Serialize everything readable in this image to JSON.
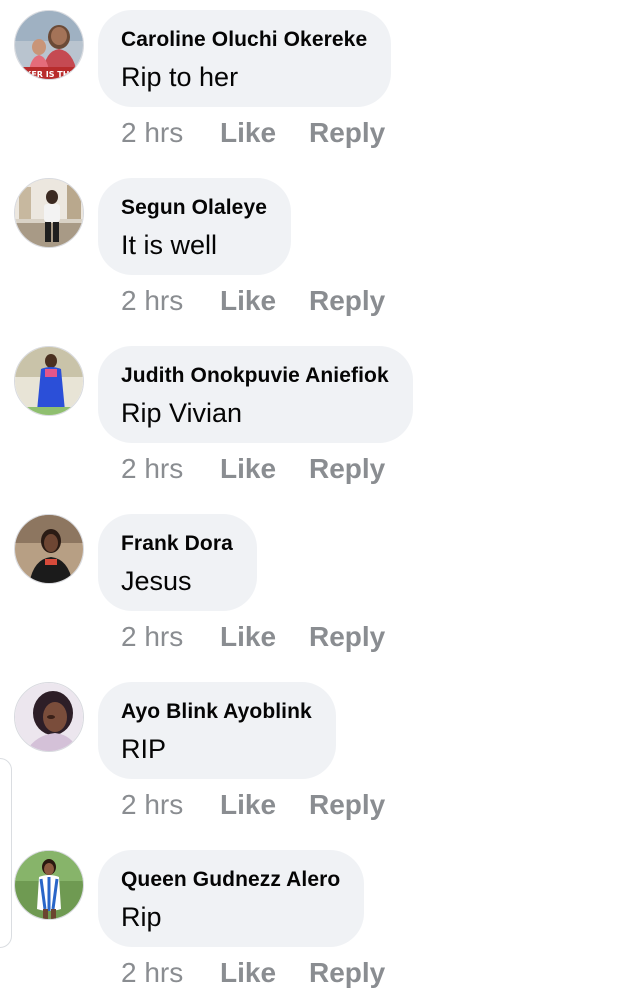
{
  "comments": [
    {
      "author": "Caroline Oluchi Okereke",
      "text": "Rip to her",
      "time": "2 hrs",
      "like": "Like",
      "reply": "Reply",
      "avatar_icon": "user-photo-icon",
      "avatar_caption": "KER IS THE"
    },
    {
      "author": "Segun Olaleye",
      "text": "It is well",
      "time": "2 hrs",
      "like": "Like",
      "reply": "Reply",
      "avatar_icon": "user-photo-icon"
    },
    {
      "author": "Judith Onokpuvie Aniefiok",
      "text": "Rip Vivian",
      "time": "2 hrs",
      "like": "Like",
      "reply": "Reply",
      "avatar_icon": "user-photo-icon"
    },
    {
      "author": "Frank Dora",
      "text": "Jesus",
      "time": "2 hrs",
      "like": "Like",
      "reply": "Reply",
      "avatar_icon": "user-photo-icon"
    },
    {
      "author": "Ayo Blink Ayoblink",
      "text": "RIP",
      "time": "2 hrs",
      "like": "Like",
      "reply": "Reply",
      "avatar_icon": "user-photo-icon"
    },
    {
      "author": "Queen Gudnezz Alero",
      "text": "Rip",
      "time": "2 hrs",
      "like": "Like",
      "reply": "Reply",
      "avatar_icon": "user-photo-icon"
    }
  ],
  "colors": {
    "bubble": "#f0f2f5",
    "name_text": "#050505",
    "meta_text": "#8a8d91"
  }
}
